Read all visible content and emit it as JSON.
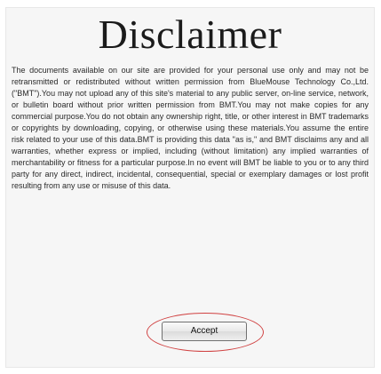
{
  "dialog": {
    "title": "Disclaimer",
    "body": "The documents available on our site are provided for your personal use only and may not be retransmitted or redistributed without written permission from BlueMouse Technology Co.,Ltd. (\"BMT\").You may not upload any of this site's material to any public server, on-line service, network, or bulletin board without prior written permission from BMT.You may not make copies for any commercial purpose.You do not obtain any ownership right, title, or other interest in BMT trademarks or copyrights by downloading, copying, or otherwise using these materials.You assume the entire risk related to your use of this data.BMT is providing this data \"as is,\" and BMT disclaims any and all warranties, whether express or implied, including (without limitation) any implied warranties of merchantability or fitness for a particular purpose.In no event will BMT be liable to you or to any third party for any direct, indirect, incidental, consequential, special or exemplary damages or lost profit resulting from any use or misuse of this data.",
    "accept_label": "Accept"
  },
  "colors": {
    "highlight_ellipse": "#d04141",
    "panel_background": "#f6f6f6"
  }
}
